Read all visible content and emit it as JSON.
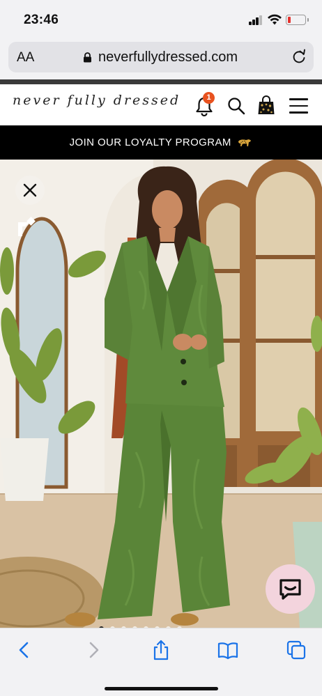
{
  "status": {
    "time": "23:46"
  },
  "browser": {
    "text_size_label": "AA",
    "url": "neverfullydressed.com"
  },
  "site": {
    "logo_text": "never fully dressed",
    "notification_count": "1",
    "promo_text": "JOIN OUR LOYALTY PROGRAM"
  },
  "colors": {
    "badge": "#e8521f",
    "promo_bg": "#000000",
    "chat_bg": "#f3d4dd",
    "accent_blue": "#1a73e8",
    "suit_green": "#5f8a3c"
  },
  "icons": [
    "signal-icon",
    "wifi-icon",
    "battery-icon",
    "lock-icon",
    "reload-icon",
    "bell-icon",
    "search-icon",
    "shopping-bag-icon",
    "menu-icon",
    "cheetah-icon",
    "close-icon",
    "brand-r-icon",
    "chat-icon",
    "back-icon",
    "forward-icon",
    "share-icon",
    "bookmarks-icon",
    "tabs-icon"
  ],
  "carousel": {
    "slide_count": 8,
    "active_index": 0
  }
}
